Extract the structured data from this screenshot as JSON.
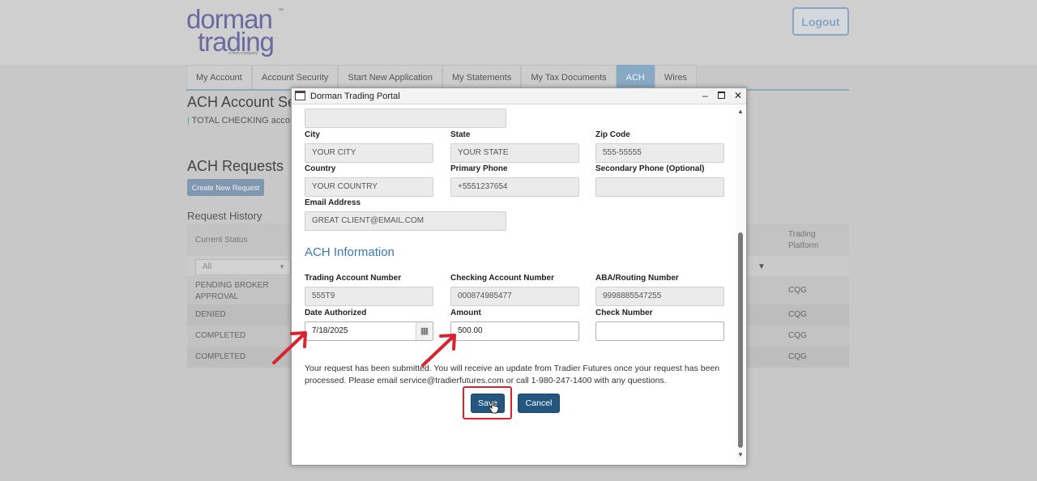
{
  "logo": {
    "line1": "dorman",
    "line2": "trading",
    "tm": "™",
    "tagline": "a mizu company"
  },
  "header": {
    "logout_label": "Logout"
  },
  "tabs": [
    {
      "label": "My Account",
      "active": false
    },
    {
      "label": "Account Security",
      "active": false
    },
    {
      "label": "Start New Application",
      "active": false
    },
    {
      "label": "My Statements",
      "active": false
    },
    {
      "label": "My Tax Documents",
      "active": false
    },
    {
      "label": "ACH",
      "active": true
    },
    {
      "label": "Wires",
      "active": false
    }
  ],
  "background": {
    "page_title": "ACH Account Se",
    "status_text": "TOTAL CHECKING acco",
    "requests_title": "ACH Requests",
    "create_request_label": "Create New Request",
    "history_title": "Request History",
    "table": {
      "col_status": "Current Status",
      "col_platform": "Trading Platform",
      "filter_value": "All",
      "rows": [
        {
          "status": "PENDING BROKER APPROVAL",
          "platform": "CQG"
        },
        {
          "status": "DENIED",
          "platform": "CQG"
        },
        {
          "status": "COMPLETED",
          "platform": "CQG"
        },
        {
          "status": "COMPLETED",
          "platform": "CQG"
        }
      ]
    }
  },
  "modal": {
    "window_title": "Dorman Trading Portal",
    "address": {
      "city_label": "City",
      "city_value": "YOUR CITY",
      "state_label": "State",
      "state_value": "YOUR STATE",
      "zip_label": "Zip Code",
      "zip_value": "555-55555",
      "country_label": "Country",
      "country_value": "YOUR COUNTRY",
      "primary_phone_label": "Primary Phone",
      "primary_phone_value": "+5551237654",
      "secondary_phone_label": "Secondary Phone (Optional)",
      "secondary_phone_value": "",
      "email_label": "Email Address",
      "email_value": "GREAT CLIENT@EMAIL.COM"
    },
    "ach": {
      "section_title": "ACH Information",
      "trading_account_label": "Trading Account Number",
      "trading_account_value": "555T9",
      "checking_account_label": "Checking Account Number",
      "checking_account_value": "000874985477",
      "routing_label": "ABA/Routing Number",
      "routing_value": "9998885547255",
      "date_label": "Date Authorized",
      "date_value": "7/18/2025",
      "amount_label": "Amount",
      "amount_value": "500.00",
      "check_number_label": "Check Number",
      "check_number_value": ""
    },
    "message": "Your request has been submitted. You will receive an update from Tradier Futures once your request has been processed. Please email service@tradierfutures.com or call 1-980-247-1400 with any questions.",
    "save_label": "Save",
    "cancel_label": "Cancel"
  },
  "annotation_colors": {
    "arrow": "#d9232e",
    "highlight": "#d9232e"
  },
  "icons": [
    "window-icon",
    "minimize-icon",
    "maximize-icon",
    "close-icon",
    "calendar-icon",
    "filter-icon",
    "check-circle-icon",
    "pointer-cursor-icon"
  ]
}
